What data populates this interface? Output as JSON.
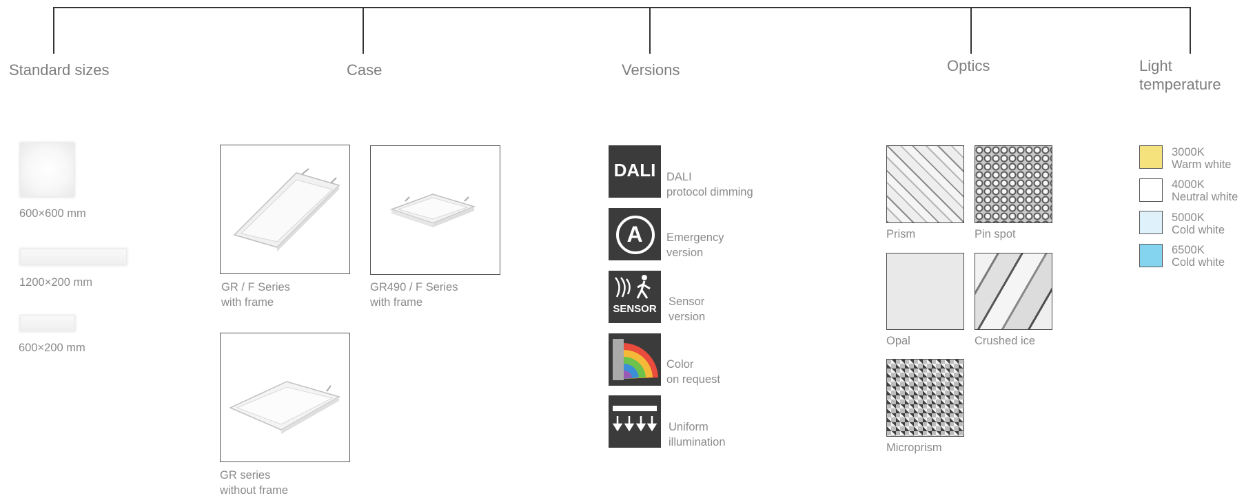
{
  "headings": {
    "sizes": "Standard sizes",
    "case": "Case",
    "versions": "Versions",
    "optics": "Optics",
    "light_line1": "Light",
    "light_line2": "temperature"
  },
  "sizes": [
    {
      "label": "600×600 mm"
    },
    {
      "label": "1200×200 mm"
    },
    {
      "label": "600×200 mm"
    }
  ],
  "cases": [
    {
      "line1": "GR / F Series",
      "line2": "with frame"
    },
    {
      "line1": "GR490 / F Series",
      "line2": "with frame"
    },
    {
      "line1": "GR series",
      "line2": "without frame"
    }
  ],
  "versions": [
    {
      "icon_name": "dali-icon",
      "icon_text": "DALI",
      "line1": "DALI",
      "line2": "protocol dimming"
    },
    {
      "icon_name": "emergency-icon",
      "icon_text": "A",
      "line1": "Emergency",
      "line2": "version"
    },
    {
      "icon_name": "sensor-icon",
      "icon_text": "SENSOR",
      "line1": "Sensor",
      "line2": "version"
    },
    {
      "icon_name": "color-fan-icon",
      "line1": "Color",
      "line2": "on request"
    },
    {
      "icon_name": "uniform-illumination-icon",
      "line1": "Uniform",
      "line2": "illumination"
    }
  ],
  "optics": [
    {
      "label": "Prism"
    },
    {
      "label": "Pin spot"
    },
    {
      "label": "Opal"
    },
    {
      "label": "Crushed ice"
    },
    {
      "label": "Microprism"
    }
  ],
  "temperatures": [
    {
      "kelvin": "3000K",
      "name": "Warm white",
      "color": "#f6e27c"
    },
    {
      "kelvin": "4000K",
      "name": "Neutral white",
      "color": "#ffffff"
    },
    {
      "kelvin": "5000K",
      "name": "Cold white",
      "color": "#dff1fa"
    },
    {
      "kelvin": "6500K",
      "name": "Cold white",
      "color": "#84d4f0"
    }
  ]
}
